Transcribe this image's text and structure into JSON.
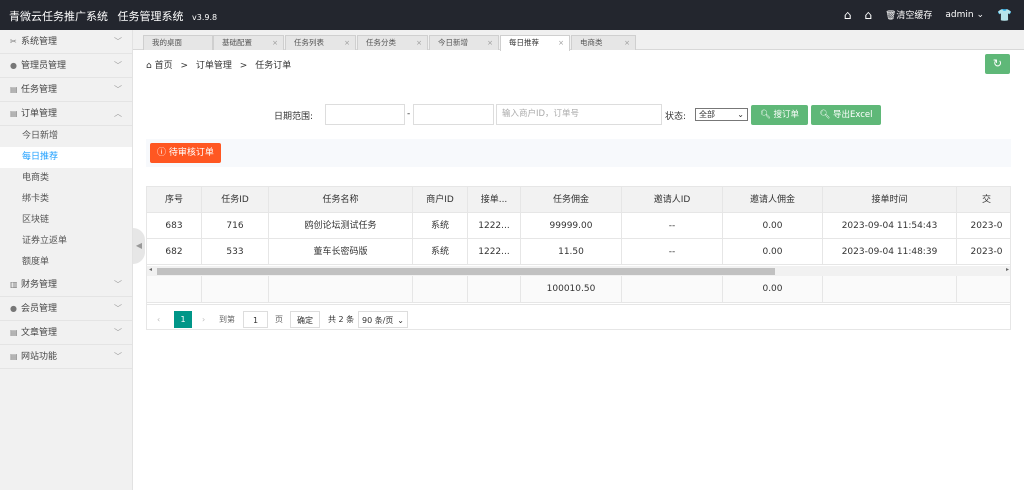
{
  "header": {
    "logo": "青微云任务推广系统",
    "title": "任务管理系统",
    "version": "v3.9.8",
    "clear_cache": "清空缓存",
    "user": "admin"
  },
  "sidebar": {
    "items": [
      {
        "label": "系统管理",
        "icon": "✂"
      },
      {
        "label": "管理员管理",
        "icon": "●"
      },
      {
        "label": "任务管理",
        "icon": "▤"
      },
      {
        "label": "订单管理",
        "icon": "▤",
        "expanded": true,
        "children": [
          "今日新增",
          "每日推荐",
          "电商类",
          "绑卡类",
          "区块链",
          "证券立返单",
          "额度单"
        ],
        "active_child": 1
      },
      {
        "label": "财务管理",
        "icon": "▥"
      },
      {
        "label": "会员管理",
        "icon": "●"
      },
      {
        "label": "文章管理",
        "icon": "▤"
      },
      {
        "label": "网站功能",
        "icon": "▤"
      }
    ]
  },
  "tabs": [
    {
      "label": "我的桌面",
      "closable": false
    },
    {
      "label": "基础配置",
      "closable": true
    },
    {
      "label": "任务列表",
      "closable": true
    },
    {
      "label": "任务分类",
      "closable": true
    },
    {
      "label": "今日新增",
      "closable": true
    },
    {
      "label": "每日推荐",
      "closable": true,
      "active": true
    },
    {
      "label": "电商类",
      "closable": true
    }
  ],
  "breadcrumb": {
    "home": "首页",
    "section": "订单管理",
    "page": "任务订单",
    "sep": ">"
  },
  "filter": {
    "date_label": "日期范围:",
    "date_sep": "-",
    "search_placeholder": "输入商户ID，订单号",
    "status_label": "状态:",
    "status_value": "全部",
    "search_button": "搜订单",
    "export_button": "导出Excel"
  },
  "pending_button": "待审核订单",
  "table": {
    "headers": [
      "序号",
      "任务ID",
      "任务名称",
      "商户ID",
      "接单...",
      "任务佣金",
      "邀请人ID",
      "邀请人佣金",
      "接单时间",
      "交"
    ],
    "rows": [
      [
        "683",
        "716",
        "鸥创论坛测试任务",
        "系统",
        "1222...",
        "99999.00",
        "--",
        "0.00",
        "2023-09-04 11:54:43",
        "2023-0"
      ],
      [
        "682",
        "533",
        "董车长密码版",
        "系统",
        "1222...",
        "11.50",
        "--",
        "0.00",
        "2023-09-04 11:48:39",
        "2023-0"
      ]
    ],
    "totals": {
      "commission": "100010.50",
      "inviter_commission": "0.00"
    }
  },
  "pager": {
    "current": "1",
    "goto_label": "到第",
    "goto_value": "1",
    "page_unit": "页",
    "confirm": "确定",
    "total": "共 2 条",
    "page_size": "90 条/页"
  },
  "colors": {
    "topbar": "#23262e",
    "green": "#5fb878",
    "orange": "#ff5722",
    "active_link": "#1e9fff"
  }
}
